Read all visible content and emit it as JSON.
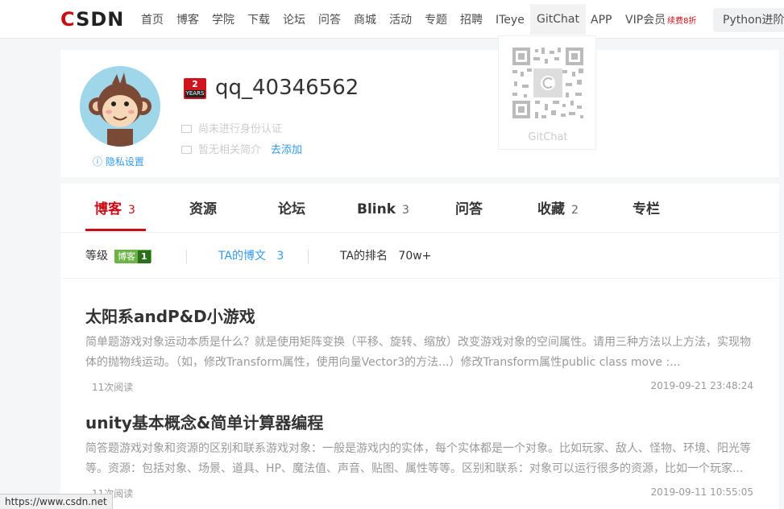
{
  "nav": {
    "logo": "CSDN",
    "items": [
      "首页",
      "博客",
      "学院",
      "下载",
      "论坛",
      "问答",
      "商城",
      "活动",
      "专题",
      "招聘",
      "ITeye",
      "GitChat",
      "APP"
    ],
    "vip_label": "VIP会员",
    "vip_discount": "续费8折",
    "search_text": "Python进阶"
  },
  "profile": {
    "years_badge_number": "2",
    "years_badge_text": "YEARS",
    "username": "qq_40346562",
    "identity_status": "尚未进行身份认证",
    "bio_status": "暂无相关简介",
    "bio_add": "去添加",
    "privacy_label": "隐私设置",
    "qr_label": "GitChat"
  },
  "tabs": [
    {
      "label": "博客",
      "count": "3"
    },
    {
      "label": "资源",
      "count": ""
    },
    {
      "label": "论坛",
      "count": ""
    },
    {
      "label": "Blink",
      "count": "3"
    },
    {
      "label": "问答",
      "count": ""
    },
    {
      "label": "收藏",
      "count": "2"
    },
    {
      "label": "专栏",
      "count": ""
    }
  ],
  "stats": {
    "level_label": "等级",
    "level_badge_text": "博客",
    "level_badge_num": "1",
    "posts_label": "TA的博文",
    "posts_count": "3",
    "rank_label": "TA的排名",
    "rank_value": "70w+"
  },
  "articles": [
    {
      "title": "太阳系andP&D小游戏",
      "desc": "简单题游戏对象运动本质是什么？就是使用矩阵变换（平移、旋转、缩放）改变游戏对象的空间属性。请用三种方法以上方法，实现物体的抛物线运动。（如，修改Transform属性，使用向量Vector3的方法...）修改Transform属性public class move :...",
      "reads": "11次阅读",
      "time": "2019-09-21 23:48:24"
    },
    {
      "title": "unity基本概念&简单计算器编程",
      "desc": "简答题游戏对象和资源的区别和联系游戏对象：一般是游戏内的实体，每个实体都是一个对象。比如玩家、敌人、怪物、环境、阳光等等。资源：包括对象、场景、道具、HP、魔法值、声音、贴图、属性等等。区别和联系：对象可以运行很多的资源，比如一个玩家...",
      "reads": "11次阅读",
      "time": "2019-09-11 10:55:05"
    }
  ],
  "status_url": "https://www.csdn.net",
  "colors": {
    "brand_red": "#ca0c16",
    "link_blue": "#3399ea",
    "badge_green": "#6cb347"
  }
}
